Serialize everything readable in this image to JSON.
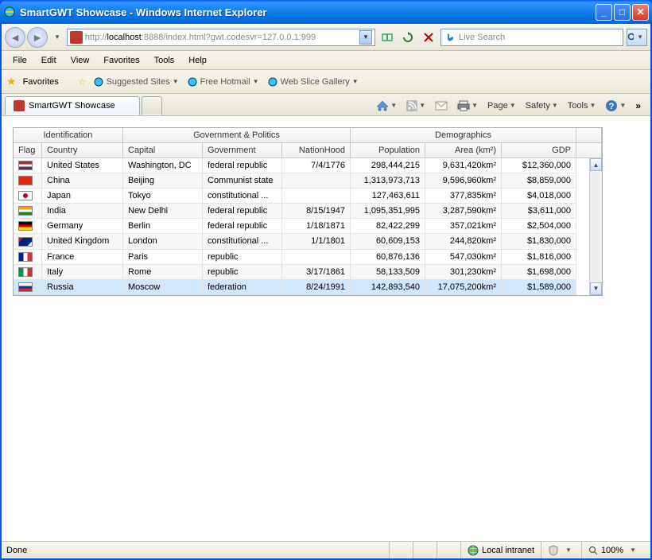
{
  "window": {
    "title": "SmartGWT Showcase - Windows Internet Explorer"
  },
  "nav": {
    "url_prefix": "http://",
    "url_host": "localhost",
    "url_suffix": ":8888/index.html?gwt.codesvr=127.0.0.1:999",
    "search_placeholder": "Live Search"
  },
  "menu": [
    "File",
    "Edit",
    "View",
    "Favorites",
    "Tools",
    "Help"
  ],
  "favbar": {
    "label": "Favorites",
    "items": [
      "Suggested Sites",
      "Free Hotmail",
      "Web Slice Gallery"
    ]
  },
  "tab": {
    "title": "SmartGWT Showcase"
  },
  "toolbar": {
    "page": "Page",
    "safety": "Safety",
    "tools": "Tools"
  },
  "grid": {
    "groups": [
      {
        "label": "Identification",
        "span": [
          "w-flag",
          "w-country"
        ]
      },
      {
        "label": "Government & Politics",
        "span": [
          "w-capital",
          "w-gov",
          "w-nation"
        ]
      },
      {
        "label": "Demographics",
        "span": [
          "w-pop",
          "w-area",
          "w-gdp"
        ]
      }
    ],
    "cols": [
      {
        "key": "flag",
        "label": "Flag",
        "w": "w-flag"
      },
      {
        "key": "country",
        "label": "Country",
        "w": "w-country"
      },
      {
        "key": "capital",
        "label": "Capital",
        "w": "w-capital"
      },
      {
        "key": "government",
        "label": "Government",
        "w": "w-gov"
      },
      {
        "key": "nationhood",
        "label": "NationHood",
        "w": "w-nation",
        "align": "ar"
      },
      {
        "key": "population",
        "label": "Population",
        "w": "w-pop",
        "align": "ar"
      },
      {
        "key": "area",
        "label": "Area (km²)",
        "w": "w-area",
        "align": "ar"
      },
      {
        "key": "gdp",
        "label": "GDP",
        "w": "w-gdp",
        "align": "ar"
      }
    ],
    "rows": [
      {
        "flag": "us",
        "country": "United States",
        "capital": "Washington, DC",
        "government": "federal republic",
        "nationhood": "7/4/1776",
        "population": "298,444,215",
        "area": "9,631,420km²",
        "gdp": "$12,360,000"
      },
      {
        "flag": "cn",
        "country": "China",
        "capital": "Beijing",
        "government": "Communist state",
        "nationhood": "",
        "population": "1,313,973,713",
        "area": "9,596,960km²",
        "gdp": "$8,859,000"
      },
      {
        "flag": "jp",
        "country": "Japan",
        "capital": "Tokyo",
        "government": "constitutional ...",
        "nationhood": "",
        "population": "127,463,611",
        "area": "377,835km²",
        "gdp": "$4,018,000"
      },
      {
        "flag": "in",
        "country": "India",
        "capital": "New Delhi",
        "government": "federal republic",
        "nationhood": "8/15/1947",
        "population": "1,095,351,995",
        "area": "3,287,590km²",
        "gdp": "$3,611,000"
      },
      {
        "flag": "de",
        "country": "Germany",
        "capital": "Berlin",
        "government": "federal republic",
        "nationhood": "1/18/1871",
        "population": "82,422,299",
        "area": "357,021km²",
        "gdp": "$2,504,000"
      },
      {
        "flag": "gb",
        "country": "United Kingdom",
        "capital": "London",
        "government": "constitutional ...",
        "nationhood": "1/1/1801",
        "population": "60,609,153",
        "area": "244,820km²",
        "gdp": "$1,830,000"
      },
      {
        "flag": "fr",
        "country": "France",
        "capital": "Paris",
        "government": "republic",
        "nationhood": "",
        "population": "60,876,136",
        "area": "547,030km²",
        "gdp": "$1,816,000"
      },
      {
        "flag": "it",
        "country": "Italy",
        "capital": "Rome",
        "government": "republic",
        "nationhood": "3/17/1861",
        "population": "58,133,509",
        "area": "301,230km²",
        "gdp": "$1,698,000"
      },
      {
        "flag": "ru",
        "country": "Russia",
        "capital": "Moscow",
        "government": "federation",
        "nationhood": "8/24/1991",
        "population": "142,893,540",
        "area": "17,075,200km²",
        "gdp": "$1,589,000",
        "selected": true
      }
    ]
  },
  "status": {
    "done": "Done",
    "zone": "Local intranet",
    "zoom": "100%"
  },
  "flag_colors": {
    "us": "linear-gradient(#b22234 33%,white 33% 66%,#3c3b6e 66%)",
    "cn": "#de2910",
    "jp": "radial-gradient(circle,#bc002d 30%,white 32%)",
    "in": "linear-gradient(#ff9933 33%,white 33% 66%,#138808 66%)",
    "de": "linear-gradient(black 33%,#dd0000 33% 66%,#ffce00 66%)",
    "gb": "linear-gradient(135deg,#cf142b 20%,#00247d 20% 80%,white 80%)",
    "fr": "linear-gradient(90deg,#002395 33%,white 33% 66%,#ed2939 66%)",
    "it": "linear-gradient(90deg,#009246 33%,white 33% 66%,#ce2b37 66%)",
    "ru": "linear-gradient(white 33%,#0039a6 33% 66%,#d52b1e 66%)"
  }
}
